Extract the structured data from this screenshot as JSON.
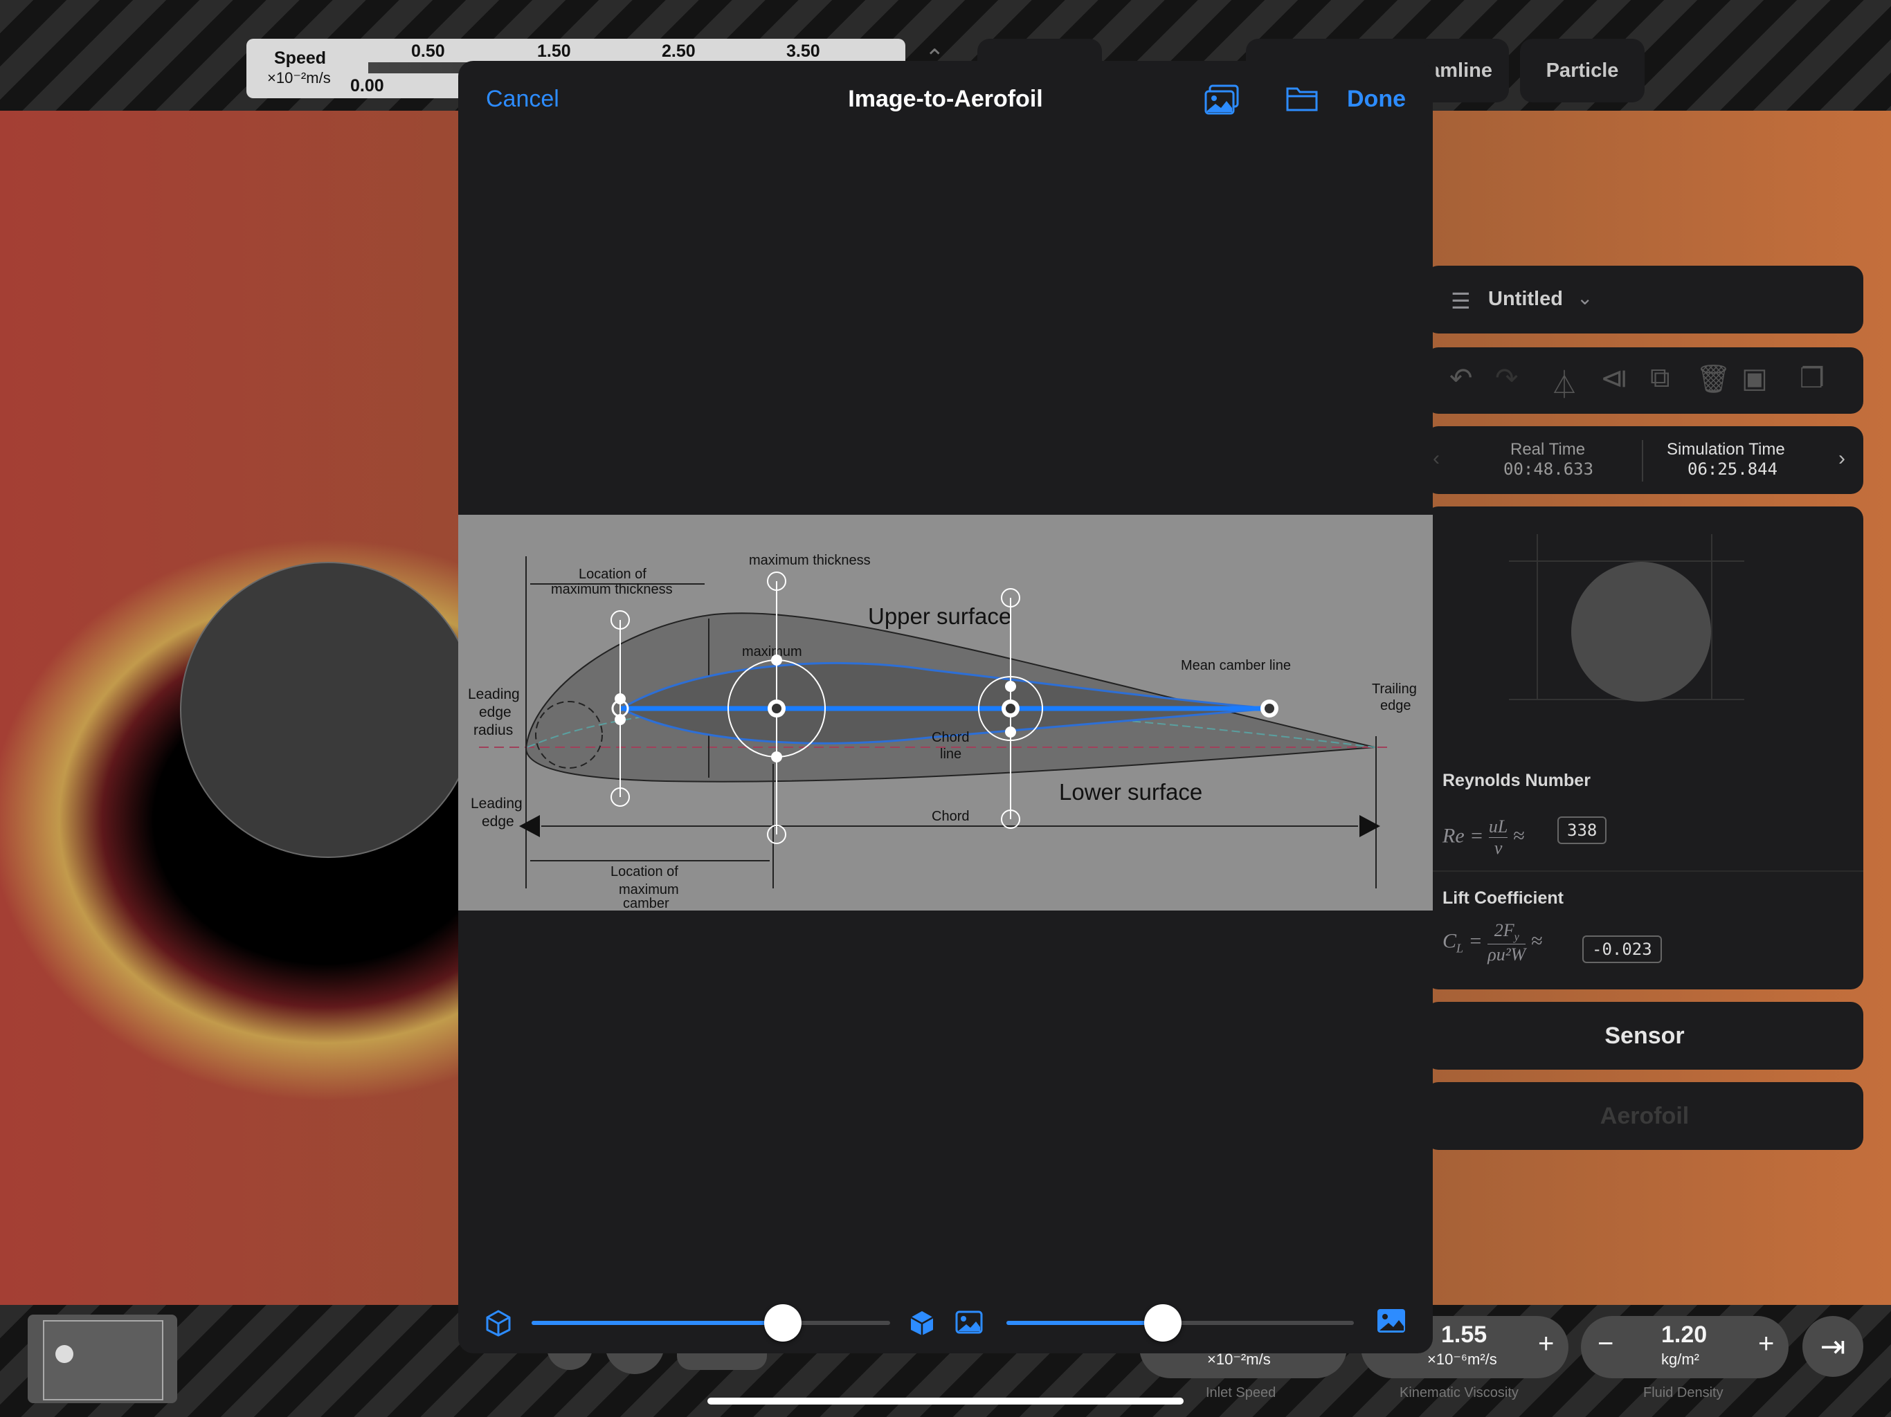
{
  "background": {
    "speed_legend": {
      "title": "Speed",
      "unit": "×10⁻²m/s",
      "ticks": [
        "0.50",
        "1.50",
        "2.50",
        "3.50"
      ],
      "min": "0.00"
    },
    "top_tabs": [
      "Streamline",
      "Particle"
    ],
    "document": {
      "title": "Untitled"
    },
    "times": {
      "real_label": "Real Time",
      "real_value": "00:48.633",
      "sim_label": "Simulation Time",
      "sim_value": "06:25.844"
    },
    "reynolds": {
      "title": "Reynolds Number",
      "value": "338"
    },
    "lift": {
      "title": "Lift Coefficient",
      "value": "-0.023"
    },
    "buttons": {
      "sensor": "Sensor",
      "aerofoil": "Aerofoil"
    },
    "steppers": {
      "inlet": {
        "unit": "×10⁻²m/s",
        "caption": "Inlet Speed"
      },
      "viscosity": {
        "value": "1.55",
        "unit": "×10⁻⁶m²/s",
        "caption": "Kinematic Viscosity",
        "plus": "+"
      },
      "density": {
        "value": "1.20",
        "unit": "kg/m²",
        "caption": "Fluid Density",
        "minus": "−",
        "plus": "+"
      }
    }
  },
  "modal": {
    "cancel": "Cancel",
    "title": "Image-to-Aerofoil",
    "done": "Done",
    "icons": [
      "photo-library-icon",
      "folder-icon",
      "cube-outline-icon",
      "cube-filled-icon",
      "image-small-icon",
      "image-large-icon"
    ],
    "diagram_labels": {
      "loc_max_thick_1": "Location of",
      "loc_max_thick_2": "maximum  thickness",
      "max_thick": "maximum  thickness",
      "upper": "Upper surface",
      "lower": "Lower surface",
      "maximum": "maximum",
      "mean_camber": "Mean camber line",
      "le_radius_1": "Leading",
      "le_radius_2": "edge",
      "le_radius_3": "radius",
      "trailing_1": "Trailing",
      "trailing_2": "edge",
      "chord_line_1": "Chord",
      "chord_line_2": "line",
      "chord": "Chord",
      "leading_edge_1": "Leading",
      "leading_edge_2": "edge",
      "loc_max_camber_1": "Location of",
      "loc_max_camber_2": "maximum",
      "loc_max_camber_3": "camber"
    },
    "sliders": {
      "left_fraction": 0.7,
      "right_fraction": 0.45
    },
    "accent": "#2d8cff"
  }
}
